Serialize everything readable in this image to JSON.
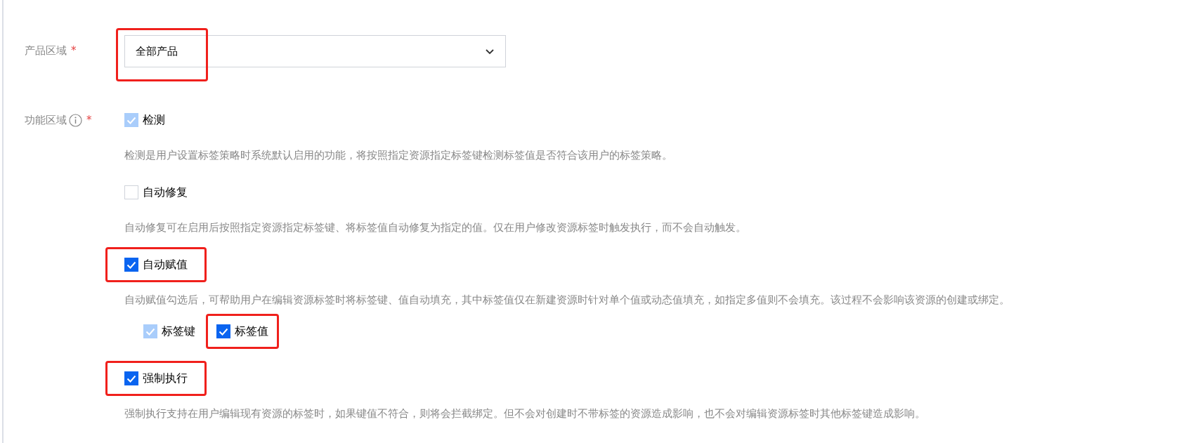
{
  "product_area": {
    "label": "产品区域",
    "required_mark": "*",
    "select": {
      "value": "全部产品",
      "highlighted": true
    }
  },
  "function_area": {
    "label": "功能区域",
    "required_mark": "*",
    "options": [
      {
        "label": "检测",
        "checked": true,
        "disabled": true,
        "highlighted": false,
        "description": "检测是用户设置标签策略时系统默认启用的功能，将按照指定资源指定标签键检测标签值是否符合该用户的标签策略。"
      },
      {
        "label": "自动修复",
        "checked": false,
        "disabled": false,
        "highlighted": false,
        "description": "自动修复可在启用后按照指定资源指定标签键、将标签值自动修复为指定的值。仅在用户修改资源标签时触发执行，而不会自动触发。"
      },
      {
        "label": "自动赋值",
        "checked": true,
        "disabled": false,
        "highlighted": true,
        "description": "自动赋值勾选后，可帮助用户在编辑资源标签时将标签键、值自动填充，其中标签值仅在新建资源时针对单个值或动态值填充，如指定多值则不会填充。该过程不会影响该资源的创建或绑定。",
        "sub_options": [
          {
            "label": "标签键",
            "checked": true,
            "disabled": true,
            "highlighted": false
          },
          {
            "label": "标签值",
            "checked": true,
            "disabled": false,
            "highlighted": true
          }
        ]
      },
      {
        "label": "强制执行",
        "checked": true,
        "disabled": false,
        "highlighted": true,
        "description": "强制执行支持在用户编辑现有资源的标签时，如果键值不符合，则将会拦截绑定。但不会对创建时不带标签的资源造成影响，也不会对编辑资源标签时其他标签键造成影响。"
      }
    ]
  }
}
